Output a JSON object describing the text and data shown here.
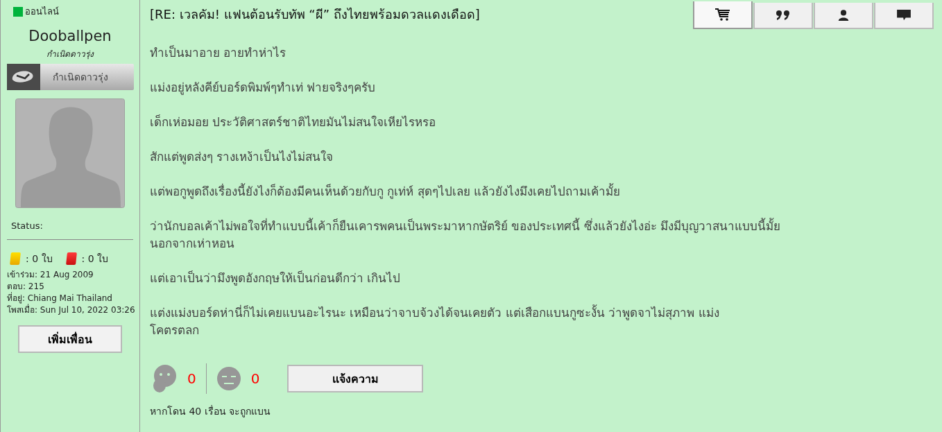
{
  "user": {
    "online": true,
    "status_text": "ออนไลน์",
    "name": "Dooballpen",
    "rank": "กำเนิดดาวรุ่ง",
    "rank_badge": "กำเนิดดาวรุ่ง",
    "status_label": "Status:",
    "cards": [
      {
        "kind": "yellow",
        "count": ": 0 ใบ"
      },
      {
        "kind": "red",
        "count": ": 0 ใบ"
      }
    ],
    "info": [
      "เข้าร่วม: 21 Aug 2009",
      "ตอบ: 215",
      "ที่อยู่: Chiang Mai Thailand",
      "โพสเมื่อ: Sun Jul 10, 2022 03:26"
    ],
    "add_friend": "เพิ่มเพื่อน"
  },
  "post": {
    "title": "[RE: เวลคัม! แฟนต้อนรับทัพ “ผี” ถึงไทยพร้อมดวลแดงเดือด]",
    "toolbar": [
      {
        "kind": "cart",
        "selected": true
      },
      {
        "kind": "quote",
        "selected": false
      },
      {
        "kind": "user",
        "selected": false
      },
      {
        "kind": "message",
        "selected": false
      }
    ],
    "paragraphs": [
      "ทำเป็นมาอาย อายทำห่าไร",
      "แม่งอยู่หลังคีย์บอร์ดพิมพ์ๆทำเท่ ฟายจริงๆครับ",
      "เด็กเห่อมอย ประวัติศาสตร์ชาติไทยมันไม่สนใจเหียไรหรอ",
      "สักแต่พูดส่งๆ รางเหง้าเป็นไงไม่สนใจ",
      "แต่พอกูพูดถึงเรื่องนี้ยังไงก็ต้องมีคนเห็นด้วยกับกู กูเท่ห์ สุดๆไปเลย แล้วยังไงมึงเคยไปถามเค้ามั้ย",
      "ว่านักบอลเค้าไม่พอใจที่ทำแบบนี้เค้าก็ยืนเคารพคนเป็นพระมาหากษัตริย์ ของประเทศนี้ ซึ่งแล้วยังไงอ่ะ มึงมีบุญวาสนาแบบนี้มั้ย\nนอกจากเห่าหอน",
      "แต่เอาเป็นว่ามึงพูดอังกฤษให้เป็นก่อนดีกว่า เกินไป",
      "แต่งแม่งบอร์ดห่านี่ก็ไม่เคยแบนอะไรนะ เหมือนว่าจาบจ้วงได้จนเคยตัว แต่เสือกแบนกูซะงั้น ว่าพูดจาไม่สุภาพ แม่ง\nโคตรตลก"
    ],
    "reactions": [
      {
        "kind": "laugh",
        "count": "0"
      },
      {
        "kind": "sad",
        "count": "0"
      }
    ],
    "report": "แจ้งความ",
    "note": "หากโดน 40 เรื่อน จะถูกแบน"
  }
}
